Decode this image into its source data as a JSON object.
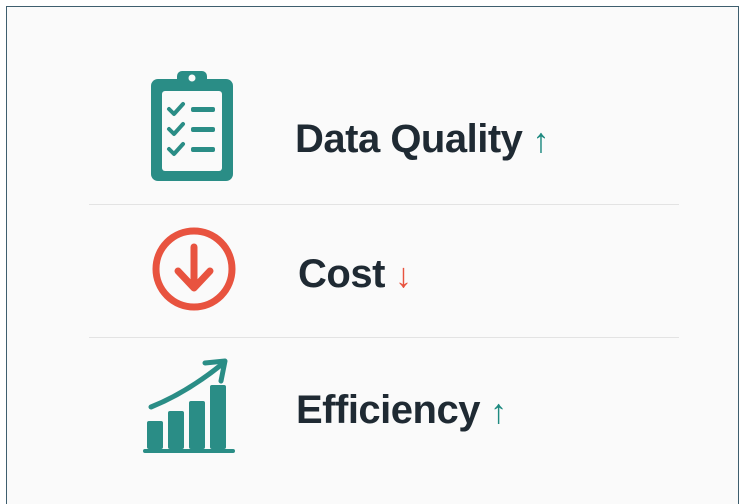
{
  "colors": {
    "teal": "#2a8d86",
    "red": "#e8533f",
    "text": "#1f2a33"
  },
  "items": [
    {
      "icon": "clipboard-checklist-icon",
      "label": "Data Quality",
      "trend_symbol": "↑",
      "trend": "up"
    },
    {
      "icon": "down-arrow-circle-icon",
      "label": "Cost",
      "trend_symbol": "↓",
      "trend": "down"
    },
    {
      "icon": "growth-bar-chart-icon",
      "label": "Efficiency",
      "trend_symbol": "↑",
      "trend": "up"
    }
  ]
}
